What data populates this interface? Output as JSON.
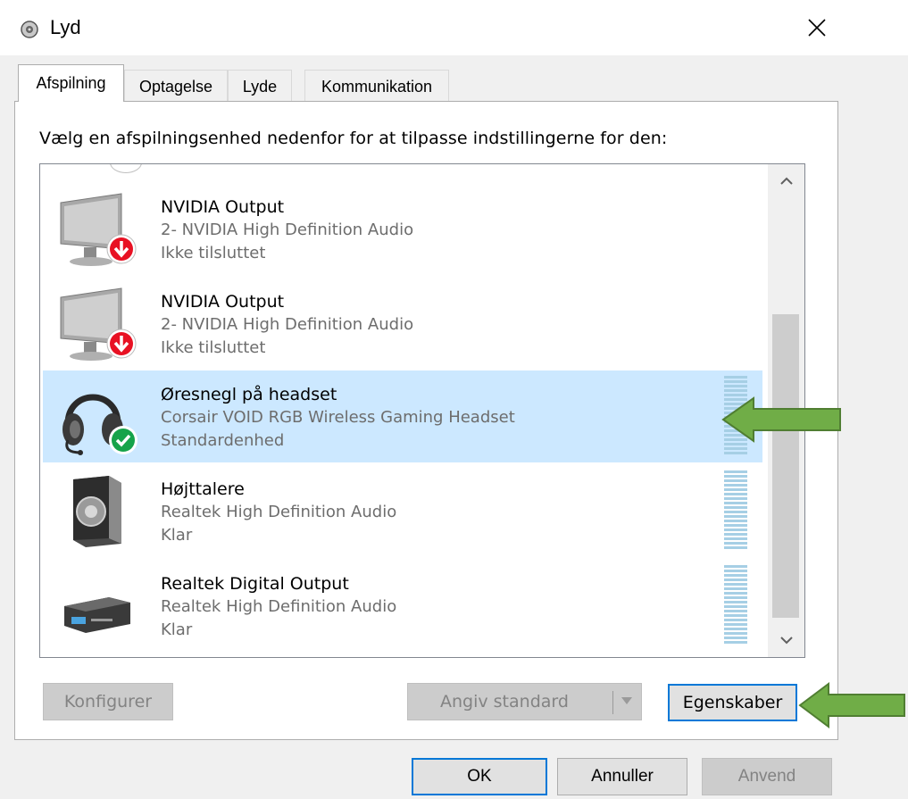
{
  "window": {
    "title": "Lyd",
    "title_icon": "speaker-icon",
    "close_glyph": "✕"
  },
  "tabs": [
    {
      "label": "Afspilning",
      "active": true
    },
    {
      "label": "Optagelse",
      "active": false
    },
    {
      "label": "Lyde",
      "active": false
    },
    {
      "label": "Kommunikation",
      "active": false
    }
  ],
  "playback": {
    "instruction": "Vælg en afspilningsenhed nedenfor for at tilpasse indstillingerne for den:",
    "devices": [
      {
        "name": "NVIDIA Output",
        "driver": "2- NVIDIA High Definition Audio",
        "status": "Ikke tilsluttet",
        "icon": "monitor-disconnected-icon"
      },
      {
        "name": "NVIDIA Output",
        "driver": "2- NVIDIA High Definition Audio",
        "status": "Ikke tilsluttet",
        "icon": "monitor-disconnected-icon"
      },
      {
        "name": "Øresnegl på headset",
        "driver": "Corsair VOID RGB Wireless Gaming Headset",
        "status": "Standardenhed",
        "icon": "headset-default-icon",
        "selected": true
      },
      {
        "name": "Højttalere",
        "driver": "Realtek High Definition Audio",
        "status": "Klar",
        "icon": "speaker-box-icon"
      },
      {
        "name": "Realtek Digital Output",
        "driver": "Realtek High Definition Audio",
        "status": "Klar",
        "icon": "digital-output-icon"
      }
    ]
  },
  "actions": {
    "configure": "Konfigurer",
    "set_default": "Angiv standard",
    "properties": "Egenskaber"
  },
  "dialog": {
    "ok": "OK",
    "cancel": "Annuller",
    "apply": "Anvend"
  },
  "colors": {
    "selection": "#cce8ff",
    "accent": "#0078d7",
    "annotation_arrow": "#70ad47",
    "disconnected_badge": "#e81123",
    "default_badge": "#16a34a"
  }
}
